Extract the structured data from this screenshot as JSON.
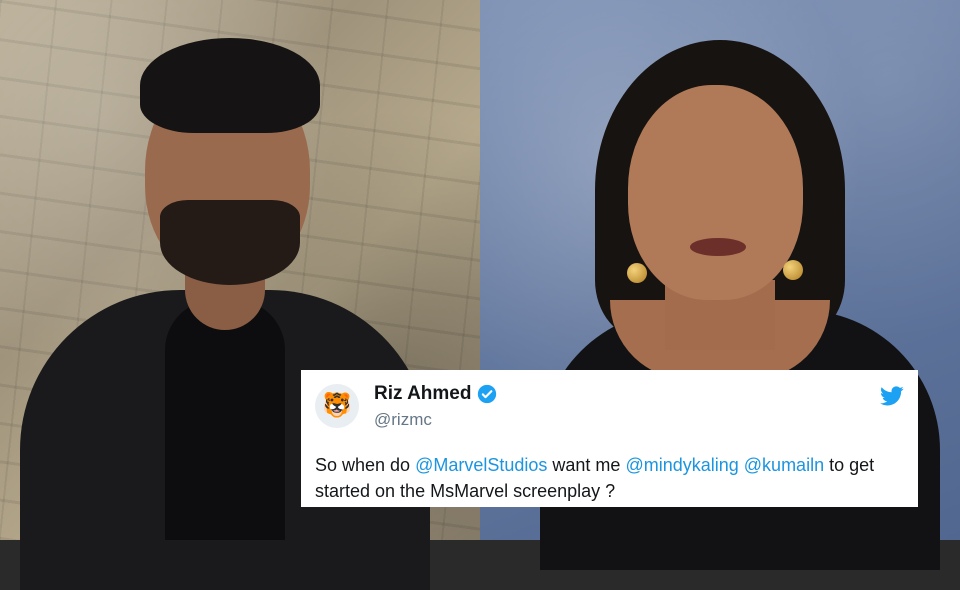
{
  "tweet": {
    "name": "Riz Ahmed",
    "handle": "@rizmc",
    "avatar_icon": "tiger-avatar-icon",
    "verified_icon": "verified-badge-icon",
    "brand_icon": "twitter-bird-icon",
    "text": {
      "part1": "So when do ",
      "mention1": "@MarvelStudios",
      "part2": " want me ",
      "mention2": "@mindykaling",
      "part3": " ",
      "mention3": "@kumailn",
      "part4": " to get started on the MsMarvel screenplay ?"
    }
  },
  "colors": {
    "mention": "#1b95e0",
    "twitter_blue": "#1da1f2",
    "handle_gray": "#657786"
  }
}
